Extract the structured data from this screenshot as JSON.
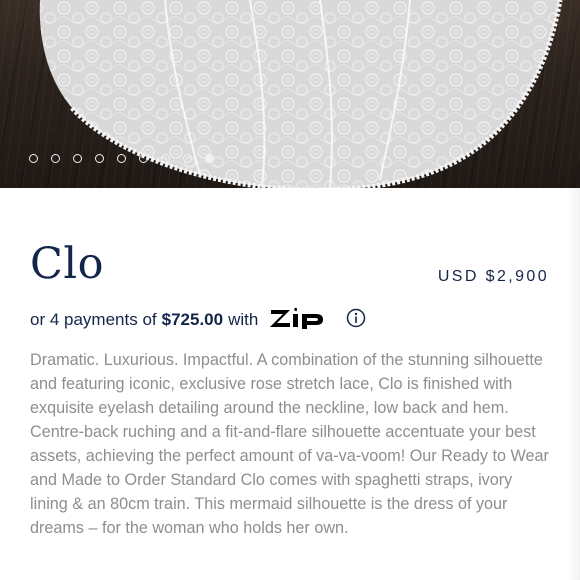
{
  "hero": {
    "image_alt": "Lace gown train on wooden floor",
    "carousel": {
      "total": 9,
      "active_index": 8
    }
  },
  "product": {
    "title": "Clo",
    "price": "USD $2,900",
    "installment": {
      "prefix": "or 4 payments of",
      "amount": "$725.00",
      "suffix": "with",
      "provider": "ZIP"
    },
    "description": "Dramatic. Luxurious. Impactful. A combination of the stunning silhouette and featuring iconic, exclusive rose stretch lace, Clo is finished with exquisite eyelash detailing around the neckline, low back and hem. Centre-back ruching and a fit-and-flare silhouette accentuate your best assets, achieving the perfect amount of va-va-voom! Our Ready to Wear and Made to Order Standard Clo comes with spaghetti straps, ivory lining & an 80cm train. This mermaid silhouette is the dress of your dreams – for the woman who holds her own."
  },
  "icons": {
    "zip": "zip-logo",
    "info": "info-circle-icon"
  },
  "colors": {
    "title": "#15254a",
    "description": "#8e8e8e",
    "hero_floor": "#2f241e",
    "lace": "#e6e6e6"
  }
}
